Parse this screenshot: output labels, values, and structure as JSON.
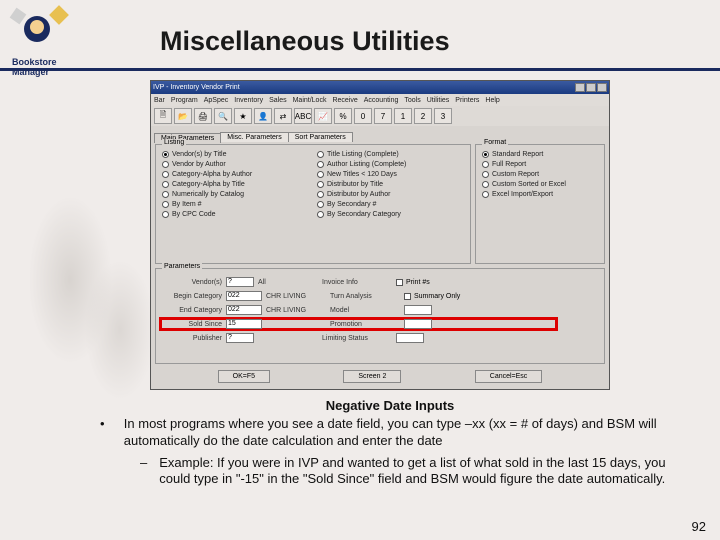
{
  "logo": {
    "line1": "Bookstore",
    "line2": "Manager"
  },
  "title": "Miscellaneous Utilities",
  "window": {
    "titlebar": "IVP - Inventory Vendor Print",
    "menus": [
      "Bar",
      "Program",
      "ApSpec",
      "Inventory",
      "Sales",
      "Maint/Lock",
      "Receive",
      "Accounting",
      "Tools",
      "Utilities",
      "Printers",
      "Help"
    ],
    "toolbar_icons": [
      "🗎",
      "📂",
      "🖨",
      "🔍",
      "★",
      "👤",
      "⇄",
      "ABC",
      "📈",
      "%",
      "0",
      "7",
      "1",
      "2",
      "3"
    ],
    "tabs": [
      "Main Parameters",
      "Misc. Parameters",
      "Sort Parameters"
    ],
    "listing_legend": "Listing",
    "listing_col1": [
      "Vendor(s) by Title",
      "Vendor by Author",
      "Category-Alpha by Author",
      "Category-Alpha by Title",
      "Numerically by Catalog",
      "By Item #",
      "By CPC Code"
    ],
    "listing_col2": [
      "Title Listing (Complete)",
      "Author Listing (Complete)",
      "New Titles < 120 Days",
      "Distributor by Title",
      "Distributor by Author",
      "By Secondary #",
      "By Secondary Category"
    ],
    "format_legend": "Format",
    "format_items": [
      "Standard Report",
      "Full Report",
      "Custom Report",
      "Custom Sorted or Excel",
      "Excel Import/Export"
    ],
    "params_legend": "Parameters",
    "params": {
      "r1_l": "Vendor(s)",
      "r1_in": "?",
      "r1_v": "All",
      "r1_rl": "Invoice Info",
      "r1_cb": "Print #s",
      "r2_l": "Begin Category",
      "r2_in": "022",
      "r2_v": "CHR LIVING",
      "r2_rl": "Turn Analysis",
      "r2_cb": "Summary Only",
      "r3_l": "End Category",
      "r3_in": "022",
      "r3_v": "CHR LIVING",
      "r3_rl": "Model",
      "r4_l": "Sold Since",
      "r4_in": "15",
      "r4_rl": "Promotion",
      "r5_l": "Publisher",
      "r5_in": "?",
      "r5_rl": "Limiting Status"
    },
    "buttons": [
      "OK=F5",
      "Screen 2",
      "Cancel=Esc"
    ]
  },
  "body": {
    "subtitle": "Negative Date Inputs",
    "bullet": "In most programs where you see a date field, you can type –xx (xx = # of days) and BSM will automatically do the date calculation and enter the date",
    "sub_bullet": "Example:  If you were in IVP and wanted to get a list of what sold in the last 15 days, you could type in \"-15\" in the \"Sold Since\" field and BSM would figure the date automatically."
  },
  "page_number": "92"
}
